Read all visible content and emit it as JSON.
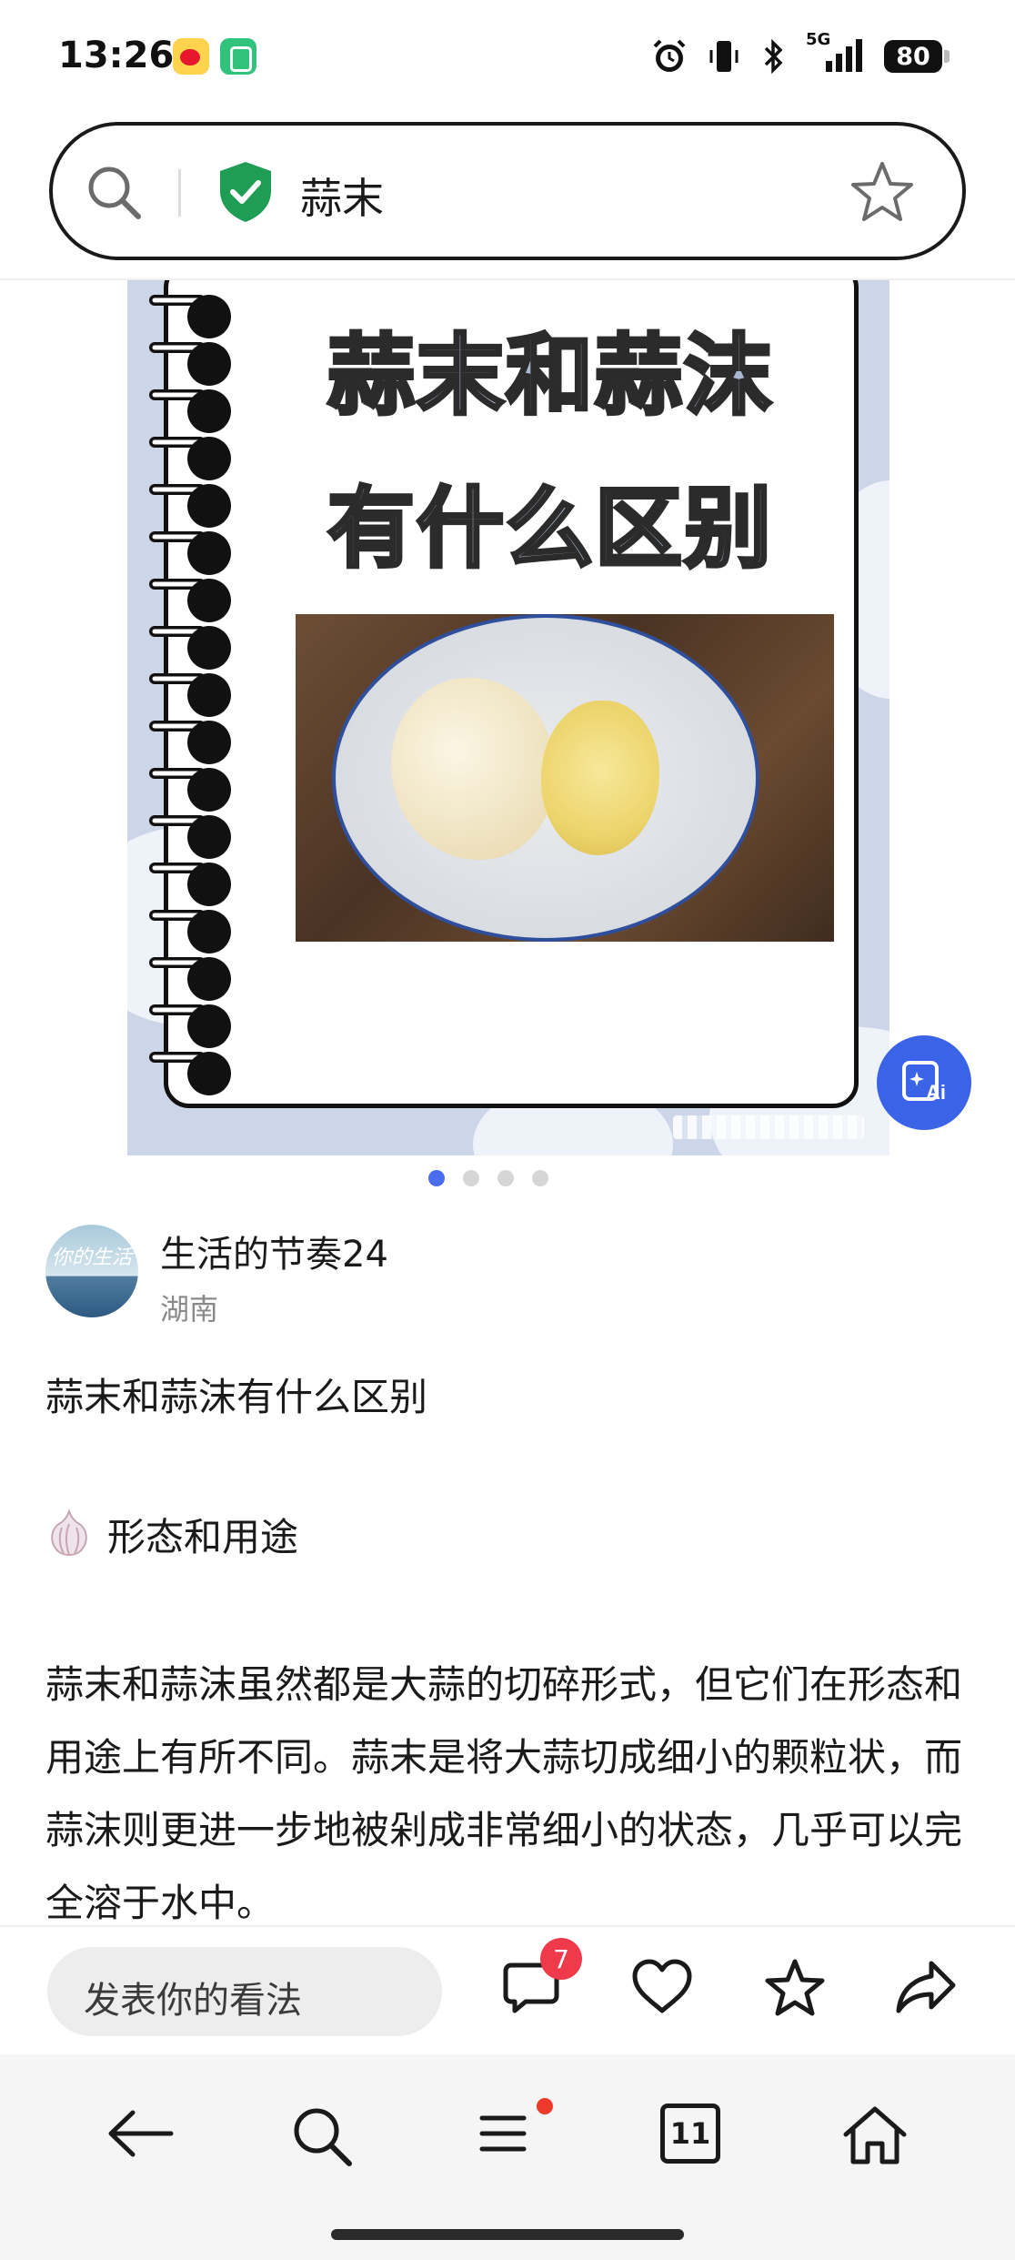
{
  "status_bar": {
    "time": "13:26",
    "network": "5G",
    "battery": "80",
    "icons": [
      "weibo-icon",
      "wechat-icon",
      "alarm-icon",
      "vibrate-icon",
      "bluetooth-icon",
      "signal-icon",
      "battery-icon"
    ]
  },
  "search": {
    "query": "蒜末",
    "icons": [
      "search-icon",
      "shield-check-icon",
      "star-outline-icon"
    ]
  },
  "post_image": {
    "title_line_1": "蒜末和蒜沫",
    "title_line_2": "有什么区别",
    "page_index": 1,
    "page_count": 4
  },
  "ai_button": {
    "icon": "ai-image-icon",
    "color": "#3a63e8"
  },
  "author": {
    "name": "生活的节奏24",
    "location": "湖南",
    "avatar_text": "你的生活"
  },
  "post": {
    "title": "蒜末和蒜沫有什么区别",
    "section_icon": "garlic-icon",
    "section_heading": "形态和用途",
    "body": "蒜末和蒜沫虽然都是大蒜的切碎形式，但它们在形态和用途上有所不同。蒜末是将大蒜切成细小的颗粒状，而蒜沫则更进一步地被剁成非常细小的状态，几乎可以完全溶于水中。"
  },
  "action_bar": {
    "comment_placeholder": "发表你的看法",
    "comment_count": "7",
    "icons": [
      "comment-icon",
      "heart-icon",
      "star-icon",
      "share-icon"
    ]
  },
  "nav_bar": {
    "tabs_count": "11",
    "icons": [
      "back-icon",
      "search-icon",
      "menu-icon",
      "tabs-icon",
      "home-icon"
    ]
  },
  "colors": {
    "accent": "#4a6df0",
    "badge": "#ee3a4a",
    "shield": "#1f9d55"
  }
}
